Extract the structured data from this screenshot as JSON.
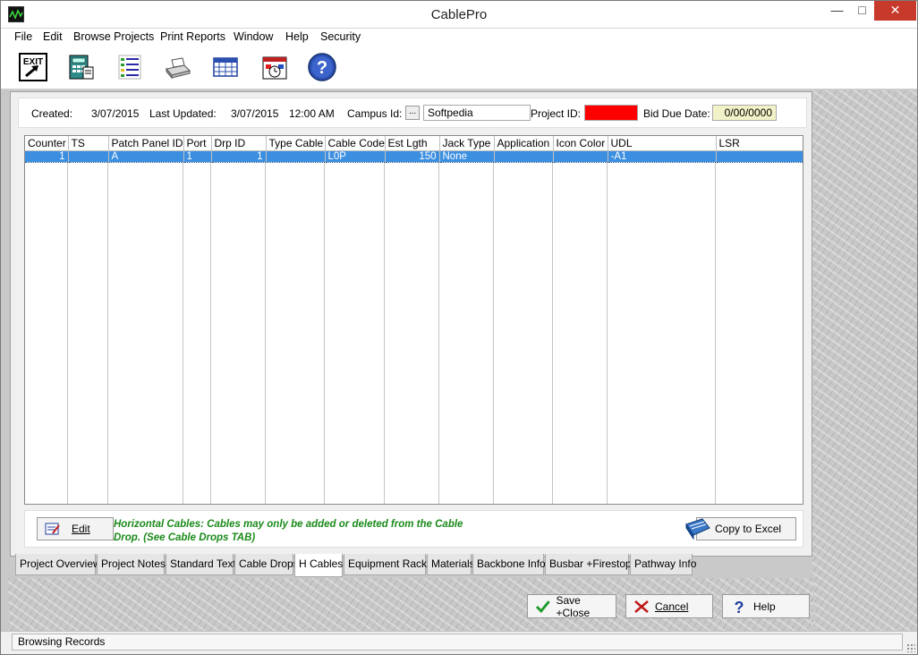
{
  "window": {
    "title": "CablePro",
    "minimize_icon": "minimize-icon",
    "maximize_icon": "maximize-icon",
    "close_icon": "close-icon"
  },
  "menu": [
    "File",
    "Edit",
    "Browse Projects",
    "Print Reports",
    "Window",
    "Help",
    "Security"
  ],
  "toolbar": {
    "exit_label": "EXIT",
    "icons": [
      "exit-icon",
      "calculator-icon",
      "list-icon",
      "printer-icon",
      "calendar-grid-icon",
      "schedule-icon",
      "help-icon"
    ]
  },
  "header": {
    "created_label": "Created:",
    "created_value": "3/07/2015",
    "updated_label": "Last Updated:",
    "updated_date": "3/07/2015",
    "updated_time": "12:00 AM",
    "campus_label": "Campus Id:",
    "campus_button": "...",
    "campus_value": "Softpedia",
    "project_id_label": "Project ID:",
    "project_id_value": "",
    "bid_due_label": "Bid Due Date:",
    "bid_due_value": "0/00/0000",
    "project_id_color": "#ff0000",
    "bid_due_color": "#f2f2c8"
  },
  "grid": {
    "columns": [
      "Counter",
      "TS",
      "Patch Panel ID",
      "Port",
      "Drp ID",
      "Type Cable",
      "Cable Code",
      "Est Lgth",
      "Jack Type",
      "Application",
      "Icon Color",
      "UDL",
      "LSR"
    ],
    "rows": [
      [
        "1",
        "",
        "A",
        "1",
        "1",
        "",
        "L0P",
        "150",
        "None",
        "",
        "",
        "-A1",
        ""
      ]
    ],
    "selection_color": "#3c8fe0"
  },
  "bottom_bar": {
    "edit_label": "Edit",
    "info_line1": "Horizontal Cables: Cables may only be added or deleted from the Cable",
    "info_line2": "Drop.  (See Cable Drops TAB)",
    "copy_label": "Copy to Excel",
    "info_color": "#1a8a1a"
  },
  "tabs": [
    "Project Overview",
    "Project Notes:",
    "Standard Text",
    "Cable Drops",
    "H Cables",
    "Equipment Racks",
    "Materials",
    "Backbone Info",
    "Busbar +Firestops",
    "Pathway Info"
  ],
  "active_tab": "H Cables",
  "footer": {
    "save_label": "Save +Close",
    "cancel_label": "Cancel",
    "help_label": "Help"
  },
  "status": {
    "text": "Browsing Records"
  }
}
